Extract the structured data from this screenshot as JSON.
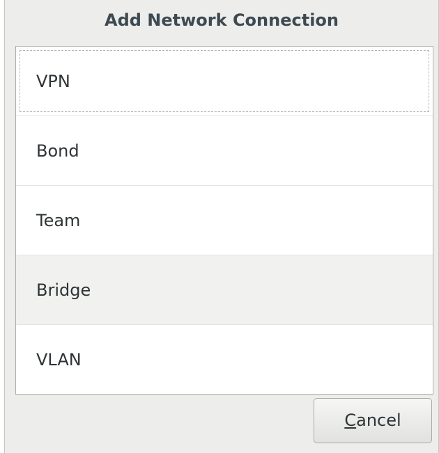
{
  "dialog": {
    "title": "Add Network Connection"
  },
  "connection_types": [
    {
      "label": "VPN",
      "focused": true,
      "hovered": false
    },
    {
      "label": "Bond",
      "focused": false,
      "hovered": false
    },
    {
      "label": "Team",
      "focused": false,
      "hovered": false
    },
    {
      "label": "Bridge",
      "focused": false,
      "hovered": true
    },
    {
      "label": "VLAN",
      "focused": false,
      "hovered": false
    }
  ],
  "buttons": {
    "cancel_mnemonic": "C",
    "cancel_rest": "ancel"
  },
  "colors": {
    "dialog_bg": "#ededec",
    "list_bg": "#ffffff",
    "hover_row_bg": "#f1f1f0",
    "title_text": "#3d4a52",
    "body_text": "#2e3436"
  }
}
